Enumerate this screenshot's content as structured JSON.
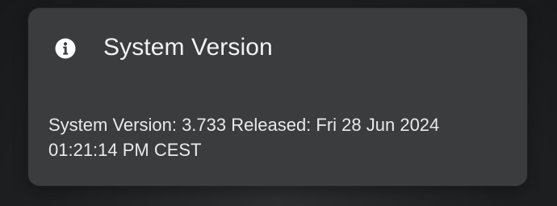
{
  "dialog": {
    "title": "System Version",
    "icon": "info-icon",
    "message": "System Version: 3.733 Released: Fri 28 Jun 2024 01:21:14 PM CEST"
  },
  "colors": {
    "background": "#1e2022",
    "card": "#3a3c3d",
    "text": "#f2f3f3",
    "icon": "#ffffff"
  }
}
